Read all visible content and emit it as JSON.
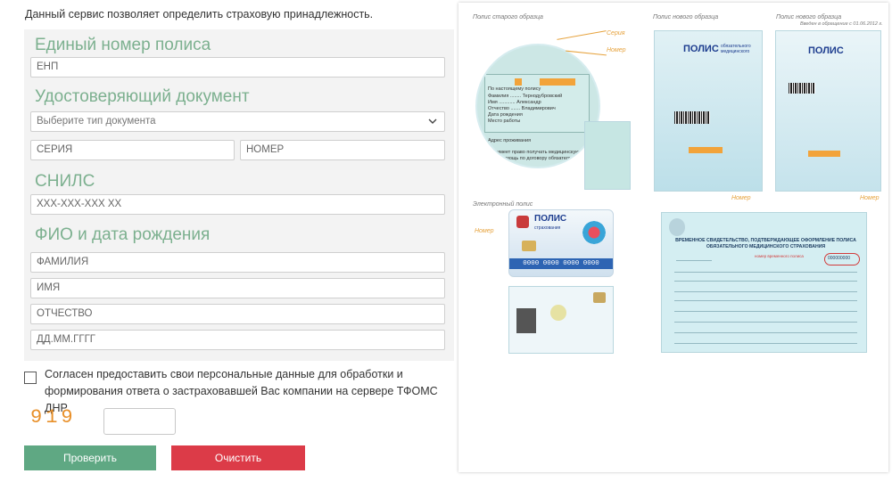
{
  "intro": "Данный сервис позволяет определить страховую принадлежность.",
  "sections": {
    "policy": "Единый номер полиса",
    "document": "Удостоверяющий документ",
    "snils": "СНИЛС",
    "fio": "ФИО и дата рождения"
  },
  "fields": {
    "enp_placeholder": "ЕНП",
    "doc_type_selected": "Выберите тип документа",
    "series_placeholder": "СЕРИЯ",
    "number_placeholder": "НОМЕР",
    "snils_placeholder": "XXX-XXX-XXX XX",
    "surname_placeholder": "ФАМИЛИЯ",
    "name_placeholder": "ИМЯ",
    "patronymic_placeholder": "ОТЧЕСТВО",
    "birthdate_placeholder": "ДД.ММ.ГГГГ"
  },
  "consent": "Согласен предоставить свои персональные данные для обработки и формирования ответа о застраховавшей Вас компании на сервере ТФОМС ДНР",
  "captcha": "919",
  "buttons": {
    "check": "Проверить",
    "clear": "Очистить"
  },
  "colors": {
    "section_title": "#7cb08f",
    "check_button": "#5fa883",
    "clear_button": "#dc3b48",
    "captcha": "#e8902a"
  },
  "image_panel": {
    "old_caption": "Полис старого образца",
    "new_caption": "Полис нового образца",
    "new_caption2": "Полис нового образца",
    "new_caption2_note": "Введен в обращение с 01.06.2012 г.",
    "series_mark": "Серия",
    "number_mark": "Номер",
    "electronic_caption": "Электронный полис",
    "polis_word": "ПОЛИС",
    "polis_sub1": "обязательного медицинского",
    "polis_sub2": "страхования",
    "card_number": "0000 0000 0000 0000",
    "temp_title": "ВРЕМЕННОЕ СВИДЕТЕЛЬСТВО, ПОДТВЕРЖДАЮЩЕЕ ОФОРМЛЕНИЕ ПОЛИСА ОБЯЗАТЕЛЬНОГО МЕДИЦИНСКОГО СТРАХОВАНИЯ",
    "temp_number_label": "номер временного полиса",
    "temp_number": "000000000"
  }
}
